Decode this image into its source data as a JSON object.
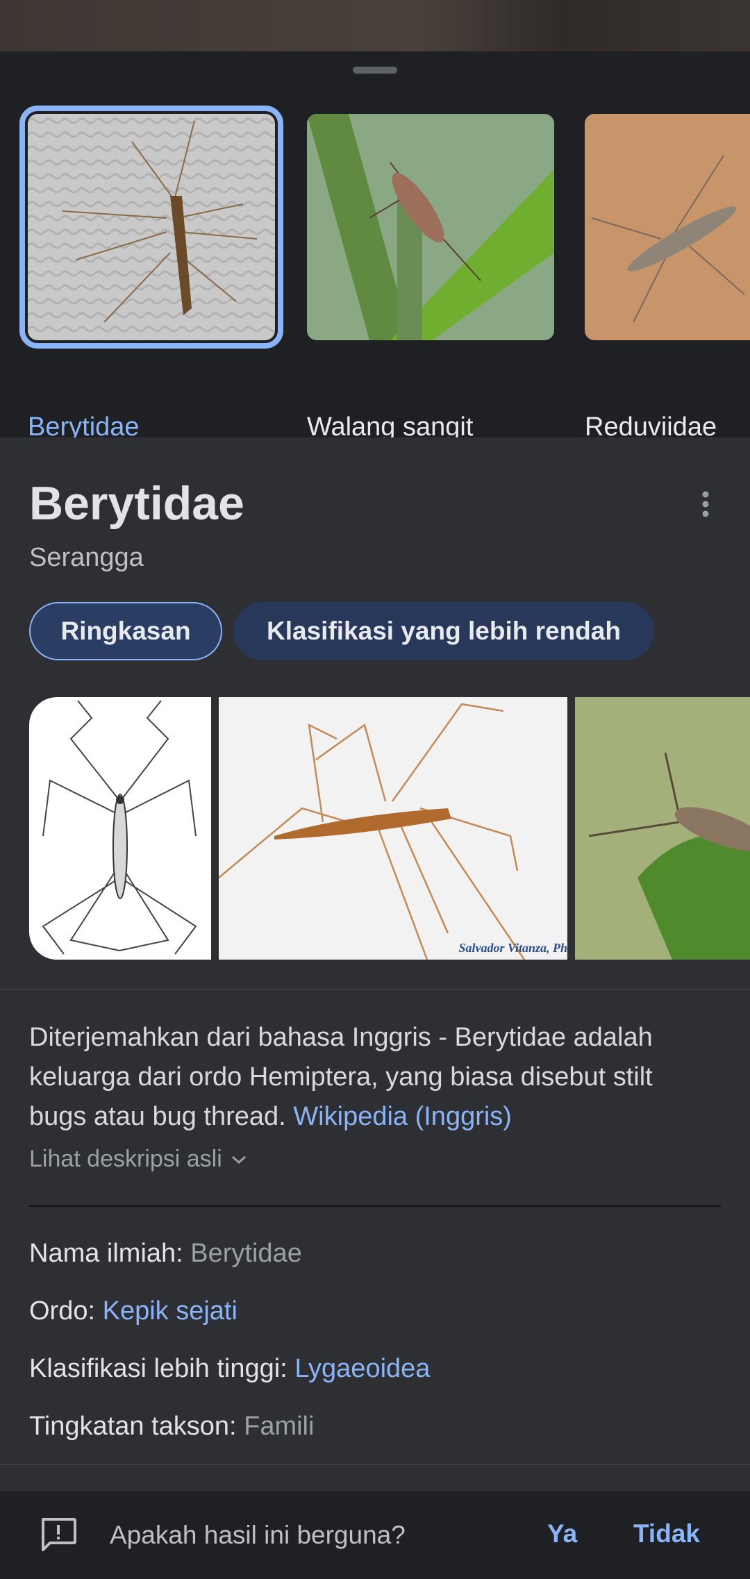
{
  "related": [
    {
      "label": "Berytidae",
      "selected": true
    },
    {
      "label": "Walang sangit",
      "selected": false
    },
    {
      "label": "Reduviidae",
      "selected": false
    }
  ],
  "entity": {
    "title": "Berytidae",
    "subtitle": "Serangga",
    "more_icon": "more-vert-icon"
  },
  "tabs": [
    {
      "label": "Ringkasan",
      "active": true
    },
    {
      "label": "Klasifikasi yang lebih rendah",
      "active": false
    }
  ],
  "gallery": {
    "watermark": "Salvador Vitanza, Ph"
  },
  "description": {
    "text": "Diterjemahkan dari bahasa Inggris - Berytidae adalah keluarga dari ordo Hemiptera, yang biasa disebut stilt bugs atau bug thread.",
    "source_link": "Wikipedia (Inggris)",
    "expand_label": "Lihat deskripsi asli"
  },
  "facts": [
    {
      "label": "Nama ilmiah:",
      "value": "Berytidae",
      "is_link": false
    },
    {
      "label": "Ordo:",
      "value": "Kepik sejati",
      "is_link": true
    },
    {
      "label": "Klasifikasi lebih tinggi:",
      "value": "Lygaeoidea",
      "is_link": true
    },
    {
      "label": "Tingkatan takson:",
      "value": "Famili",
      "is_link": false
    }
  ],
  "feedback": {
    "question": "Apakah hasil ini berguna?",
    "yes": "Ya",
    "no": "Tidak"
  },
  "colors": {
    "accent": "#8ab4f8",
    "panel": "#2e2f33",
    "sheet": "#1f2024"
  }
}
